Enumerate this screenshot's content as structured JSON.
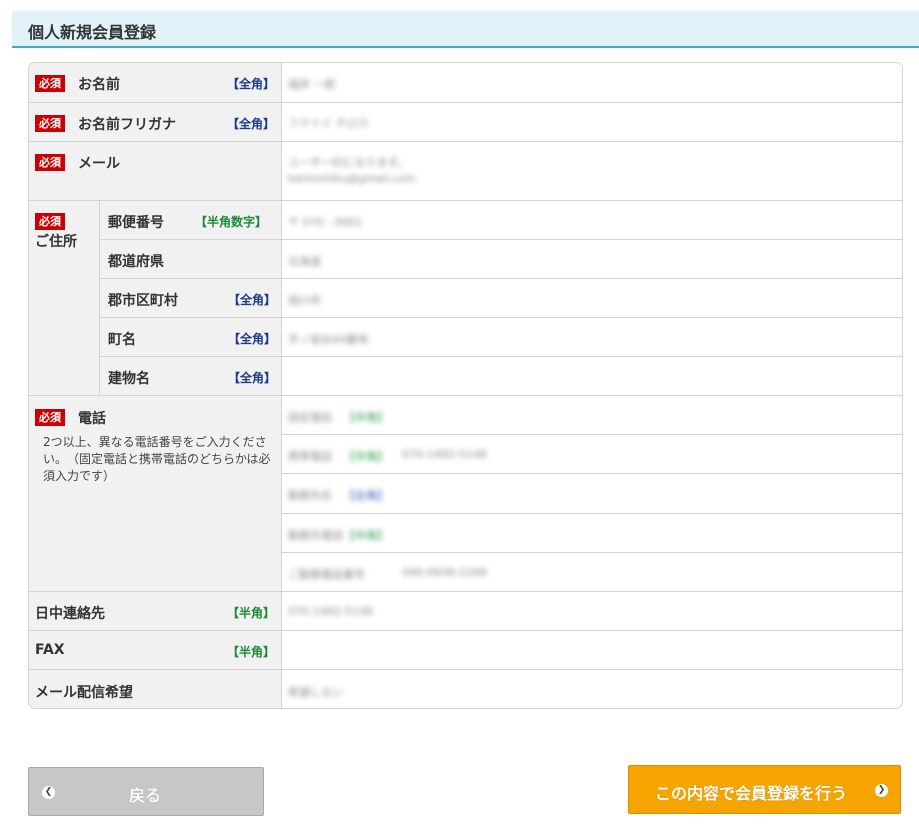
{
  "page": {
    "title": "個人新規会員登録"
  },
  "labels": {
    "required": "必須",
    "name": "お名前",
    "name_kana": "お名前フリガナ",
    "email": "メール",
    "address": "ご住所",
    "postal": "郵便番号",
    "prefecture": "都道府県",
    "city": "郡市区町村",
    "town": "町名",
    "building": "建物名",
    "phone": "電話",
    "phone_desc": "2つ以上、異なる電話番号をご入力ください。　（固定電話と携帯電話のどちらかは必須入力です）",
    "day_contact": "日中連絡先",
    "fax": "FAX",
    "mail_pref": "メール配信希望"
  },
  "notes": {
    "zenkaku": "【全角】",
    "hankaku_num": "【半角数字】",
    "hankaku": "【半角】"
  },
  "values": {
    "name": "福井 一郎",
    "name_kana": "フクイイ チロウ",
    "email_line1": "ユーザーIDになります。",
    "email_line2": "kamoshiku@gmail.com",
    "postal": "〒 070 - 0001",
    "prefecture": "北海道",
    "city": "旭川市",
    "town": "字ノ坂台44番地",
    "phone_fixed_label": "固定電話",
    "phone_fixed_note": "【半角】",
    "phone_mobile_label": "携帯電話",
    "phone_mobile_note": "【半角】",
    "phone_mobile_value": "070-1492-5148",
    "phone_work_label": "勤務先名",
    "phone_work_note": "【全角】",
    "phone_workno_label": "勤務先電話",
    "phone_workno_note": "【半角】",
    "phone_other_label": "ご勤務電話番号",
    "phone_other_value": "090-0938-2168",
    "day_contact": "070-1492-5148",
    "mail_pref": "希望しない"
  },
  "buttons": {
    "back": "戻る",
    "submit": "この内容で会員登録を行う"
  }
}
